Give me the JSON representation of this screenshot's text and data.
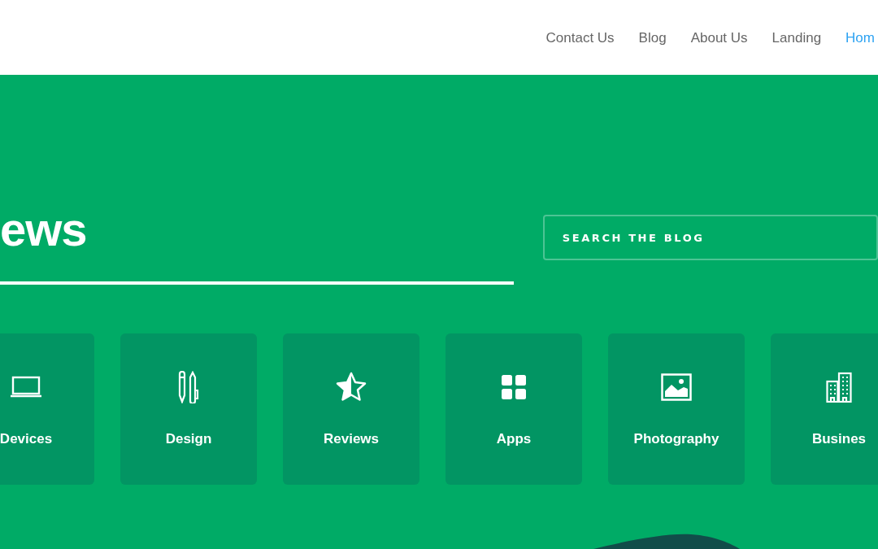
{
  "nav": [
    {
      "label": "Contact Us",
      "selected": false
    },
    {
      "label": "Blog",
      "selected": false
    },
    {
      "label": "About Us",
      "selected": false
    },
    {
      "label": "Landing",
      "selected": false
    },
    {
      "label": "Hom",
      "selected": true
    }
  ],
  "hero": {
    "heading": "ews",
    "search": {
      "placeholder": "SEARCH THE BLOG"
    }
  },
  "categories": [
    {
      "label": "Devices",
      "kind": "laptop"
    },
    {
      "label": "Design",
      "kind": "pencils"
    },
    {
      "label": "Reviews",
      "kind": "star"
    },
    {
      "label": "Apps",
      "kind": "grid"
    },
    {
      "label": "Photography",
      "kind": "image"
    },
    {
      "label": "Busines",
      "kind": "building"
    }
  ]
}
